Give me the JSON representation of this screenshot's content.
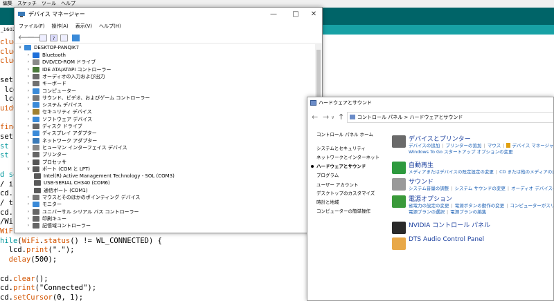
{
  "ide": {
    "menu": [
      "編集",
      "スケッチ",
      "ツール",
      "ヘルプ"
    ],
    "tab": "_1602_",
    "code_lines": [
      {
        "parts": [
          {
            "t": "clud",
            "c": "orange"
          }
        ]
      },
      {
        "parts": [
          {
            "t": "clud",
            "c": "orange"
          }
        ]
      },
      {
        "parts": [
          {
            "t": "clud",
            "c": "orange"
          }
        ]
      },
      {
        "parts": [
          {
            "t": "",
            "c": "plain"
          }
        ]
      },
      {
        "parts": [
          {
            "t": "set",
            "c": "plain"
          }
        ]
      },
      {
        "parts": [
          {
            "t": " lcd",
            "c": "plain"
          }
        ]
      },
      {
        "parts": [
          {
            "t": " lcd",
            "c": "plain"
          }
        ]
      },
      {
        "parts": [
          {
            "t": "uidC",
            "c": "orange"
          }
        ]
      },
      {
        "parts": [
          {
            "t": "",
            "c": "plain"
          }
        ]
      },
      {
        "parts": [
          {
            "t": "fine",
            "c": "orange"
          }
        ]
      },
      {
        "parts": [
          {
            "t": "set",
            "c": "plain"
          }
        ]
      },
      {
        "parts": [
          {
            "t": "st c",
            "c": "teal"
          }
        ]
      },
      {
        "parts": [
          {
            "t": "st c",
            "c": "teal"
          }
        ]
      },
      {
        "parts": [
          {
            "t": "",
            "c": "plain"
          }
        ]
      },
      {
        "parts": [
          {
            "t": "d se",
            "c": "teal"
          }
        ]
      },
      {
        "parts": [
          {
            "t": "/ in",
            "c": "plain"
          }
        ]
      },
      {
        "parts": [
          {
            "t": "cd.i",
            "c": "plain"
          }
        ]
      },
      {
        "parts": [
          {
            "t": "/ tu",
            "c": "plain"
          }
        ]
      },
      {
        "parts": [
          {
            "t": "cd.b",
            "c": "plain"
          }
        ]
      },
      {
        "parts": [
          {
            "t": "/WiF",
            "c": "plain"
          }
        ]
      },
      {
        "parts": [
          {
            "t": "WiFi.",
            "c": "orange"
          }
        ]
      },
      {
        "parts": [
          {
            "t": "hile",
            "c": "teal"
          },
          {
            "t": "(",
            "c": "plain"
          },
          {
            "t": "WiFi",
            "c": "orange"
          },
          {
            "t": ".",
            "c": "plain"
          },
          {
            "t": "status",
            "c": "orange"
          },
          {
            "t": "() != WL_CONNECTED) {",
            "c": "plain"
          }
        ]
      },
      {
        "parts": [
          {
            "t": "  lcd.",
            "c": "plain"
          },
          {
            "t": "print",
            "c": "orange"
          },
          {
            "t": "(\".\");",
            "c": "plain"
          }
        ]
      },
      {
        "parts": [
          {
            "t": "  ",
            "c": "plain"
          },
          {
            "t": "delay",
            "c": "orange"
          },
          {
            "t": "(500);",
            "c": "plain"
          }
        ]
      },
      {
        "parts": [
          {
            "t": "",
            "c": "plain"
          }
        ]
      },
      {
        "parts": [
          {
            "t": "cd.",
            "c": "plain"
          },
          {
            "t": "clear",
            "c": "orange"
          },
          {
            "t": "();",
            "c": "plain"
          }
        ]
      },
      {
        "parts": [
          {
            "t": "cd.",
            "c": "plain"
          },
          {
            "t": "print",
            "c": "orange"
          },
          {
            "t": "(\"Connected\");",
            "c": "plain"
          }
        ]
      },
      {
        "parts": [
          {
            "t": "cd.",
            "c": "plain"
          },
          {
            "t": "setCursor",
            "c": "orange"
          },
          {
            "t": "(0, 1);",
            "c": "plain"
          }
        ]
      }
    ]
  },
  "device_manager": {
    "title": "デバイス マネージャー",
    "menu": [
      "ファイル(F)",
      "操作(A)",
      "表示(V)",
      "ヘルプ(H)"
    ],
    "root": "DESKTOP-PANQIK7",
    "tree": [
      {
        "label": "Bluetooth",
        "level": 1,
        "expander": ">",
        "icon_color": "#1e6fd9"
      },
      {
        "label": "DVD/CD-ROM ドライブ",
        "level": 1,
        "expander": ">",
        "icon_color": "#8a8a8a"
      },
      {
        "label": "IDE ATA/ATAPI コントローラー",
        "level": 1,
        "expander": ">",
        "icon_color": "#4a7a3a"
      },
      {
        "label": "オーディオの入力および出力",
        "level": 1,
        "expander": ">",
        "icon_color": "#6a6a6a"
      },
      {
        "label": "キーボード",
        "level": 1,
        "expander": ">",
        "icon_color": "#707070"
      },
      {
        "label": "コンピューター",
        "level": 1,
        "expander": ">",
        "icon_color": "#3a8ad8"
      },
      {
        "label": "サウンド、ビデオ、およびゲーム コントローラー",
        "level": 1,
        "expander": ">",
        "icon_color": "#777777"
      },
      {
        "label": "システム デバイス",
        "level": 1,
        "expander": ">",
        "icon_color": "#3a8ad8"
      },
      {
        "label": "セキュリティ デバイス",
        "level": 1,
        "expander": ">",
        "icon_color": "#a08030"
      },
      {
        "label": "ソフトウェア デバイス",
        "level": 1,
        "expander": ">",
        "icon_color": "#3a8ad8"
      },
      {
        "label": "ディスク ドライブ",
        "level": 1,
        "expander": ">",
        "icon_color": "#666666"
      },
      {
        "label": "ディスプレイ アダプター",
        "level": 1,
        "expander": ">",
        "icon_color": "#3a8ad8"
      },
      {
        "label": "ネットワーク アダプター",
        "level": 1,
        "expander": ">",
        "icon_color": "#3a7ab8"
      },
      {
        "label": "ヒューマン インターフェイス デバイス",
        "level": 1,
        "expander": ">",
        "icon_color": "#888888"
      },
      {
        "label": "プリンター",
        "level": 1,
        "expander": ">",
        "icon_color": "#666666"
      },
      {
        "label": "プロセッサ",
        "level": 1,
        "expander": ">",
        "icon_color": "#555555"
      },
      {
        "label": "ポート (COM と LPT)",
        "level": 1,
        "expander": "v",
        "icon_color": "#5a5a5a"
      },
      {
        "label": "Intel(R) Active Management Technology - SOL (COM3)",
        "level": 2,
        "expander": "",
        "icon_color": "#5a5a5a"
      },
      {
        "label": "USB-SERIAL CH340 (COM6)",
        "level": 2,
        "expander": "",
        "icon_color": "#5a5a5a"
      },
      {
        "label": "通信ポート (COM1)",
        "level": 2,
        "expander": "",
        "icon_color": "#5a5a5a"
      },
      {
        "label": "マウスとそのほかのポインティング デバイス",
        "level": 1,
        "expander": ">",
        "icon_color": "#777777"
      },
      {
        "label": "モニター",
        "level": 1,
        "expander": ">",
        "icon_color": "#3a8ad8"
      },
      {
        "label": "ユニバーサル シリアル バス コントローラー",
        "level": 1,
        "expander": ">",
        "icon_color": "#666666"
      },
      {
        "label": "印刷キュー",
        "level": 1,
        "expander": ">",
        "icon_color": "#666666"
      },
      {
        "label": "記憶域コントローラー",
        "level": 1,
        "expander": ">",
        "icon_color": "#666666"
      }
    ]
  },
  "control_panel": {
    "title": "ハードウェアとサウンド",
    "address": "コントロール パネル  >  ハードウェアとサウンド",
    "left_links": [
      {
        "label": "コントロール パネル ホーム",
        "current": false
      },
      {
        "label": "システムとセキュリティ",
        "current": false
      },
      {
        "label": "ネットワークとインターネット",
        "current": false
      },
      {
        "label": "ハードウェアとサウンド",
        "current": true
      },
      {
        "label": "プログラム",
        "current": false
      },
      {
        "label": "ユーザー アカウント",
        "current": false
      },
      {
        "label": "デスクトップのカスタマイズ",
        "current": false
      },
      {
        "label": "時計と地域",
        "current": false
      },
      {
        "label": "コンピューターの簡単操作",
        "current": false
      }
    ],
    "categories": [
      {
        "title": "デバイスとプリンター",
        "icon": "printer-icon",
        "icon_color": "#6a6a6a",
        "lines": [
          [
            {
              "t": "デバイスの追加"
            },
            {
              "t": "プリンターの追加"
            },
            {
              "t": "マウス"
            },
            {
              "t": "デバイス マネージャー",
              "shield": true
            }
          ],
          [
            {
              "t": "Windows To Go スタートアップ オプションの変更"
            }
          ]
        ]
      },
      {
        "title": "自動再生",
        "icon": "autoplay-icon",
        "icon_color": "#2e9a3e",
        "lines": [
          [
            {
              "t": "メディアまたはデバイスの既定設定の変更"
            },
            {
              "t": "CD または他のメディアの自動再生"
            }
          ]
        ]
      },
      {
        "title": "サウンド",
        "icon": "speaker-icon",
        "icon_color": "#9a9a9a",
        "lines": [
          [
            {
              "t": "システム音量の調整"
            },
            {
              "t": "システム サウンドの変更"
            },
            {
              "t": "オーディオ デバイスの管理"
            }
          ]
        ]
      },
      {
        "title": "電源オプション",
        "icon": "power-options-icon",
        "icon_color": "#3a9a3a",
        "lines": [
          [
            {
              "t": "省電力の設定の変更"
            },
            {
              "t": "電源ボタンの動作の変更"
            },
            {
              "t": "コンピューターがスリープ"
            }
          ],
          [
            {
              "t": "電源プランの選択"
            },
            {
              "t": "電源プランの編集"
            }
          ]
        ]
      },
      {
        "title": "NVIDIA コントロール パネル",
        "icon": "nvidia-icon",
        "icon_color": "#2a2a2a",
        "lines": []
      },
      {
        "title": "DTS Audio Control Panel",
        "icon": "dts-icon",
        "icon_color": "#e8a848",
        "lines": []
      }
    ]
  }
}
